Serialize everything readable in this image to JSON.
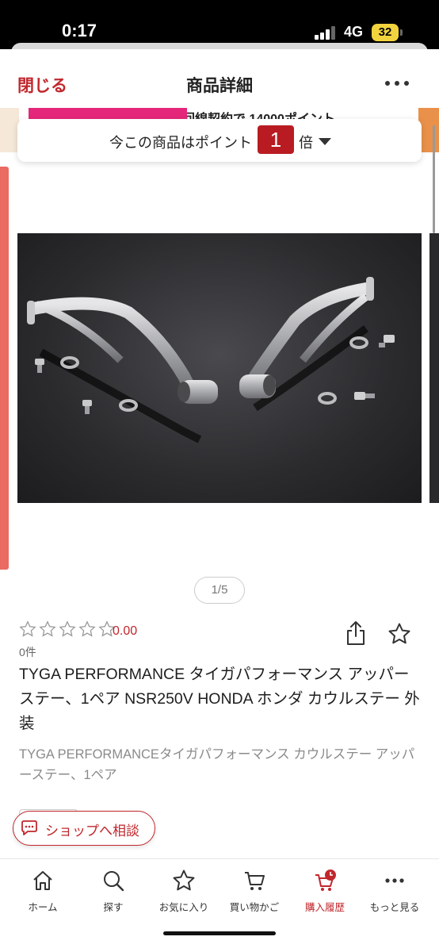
{
  "status_bar": {
    "time": "0:17",
    "network": "4G",
    "battery": "32"
  },
  "header": {
    "close_label": "閉じる",
    "title": "商品詳細"
  },
  "banner": {
    "text": "回線契約で 14000ポイント"
  },
  "point_card": {
    "prefix": "今この商品はポイント",
    "multiplier": "1",
    "suffix": "倍"
  },
  "gallery": {
    "page_indicator": "1/5"
  },
  "product": {
    "rating": "0.00",
    "rating_fraction": 0,
    "review_count": "0件",
    "title": "TYGA PERFORMANCE タイガパフォーマンス アッパーステー、1ペア NSR250V HONDA ホンダ カウルステー 外装",
    "subtitle": "TYGA PERFORMANCEタイガパフォーマンス カウルステー アッパーステー、1ペア"
  },
  "shop_button": {
    "label": "ショップへ相談"
  },
  "bottom_nav": {
    "items": [
      {
        "label": "ホーム",
        "icon": "home-icon"
      },
      {
        "label": "探す",
        "icon": "search-icon"
      },
      {
        "label": "お気に入り",
        "icon": "star-icon"
      },
      {
        "label": "買い物かご",
        "icon": "cart-icon"
      },
      {
        "label": "購入履歴",
        "icon": "purchase-history-icon"
      },
      {
        "label": "もっと見る",
        "icon": "more-icon"
      }
    ],
    "active_index": 4
  },
  "colors": {
    "accent": "#c1272d",
    "badge": "#b81c22",
    "bar": "#ea6b62"
  }
}
